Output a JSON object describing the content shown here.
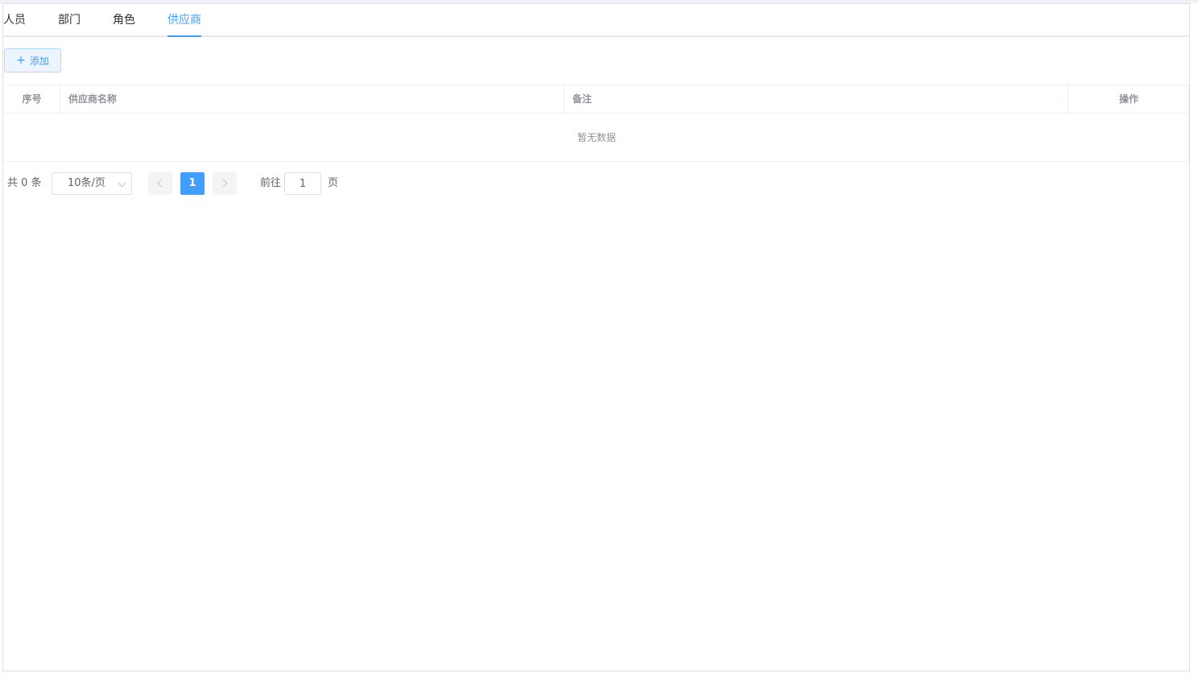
{
  "tabs": [
    {
      "label": "人员",
      "active": false
    },
    {
      "label": "部门",
      "active": false
    },
    {
      "label": "角色",
      "active": false
    },
    {
      "label": "供应商",
      "active": true
    }
  ],
  "toolbar": {
    "add_label": "添加",
    "add_icon": "+"
  },
  "table": {
    "columns": [
      "序号",
      "供应商名称",
      "备注",
      "操作"
    ],
    "rows": [],
    "empty_text": "暂无数据"
  },
  "pagination": {
    "total_text": "共 0 条",
    "page_size_label": "10条/页",
    "current_page": "1",
    "goto_prefix": "前往",
    "goto_value": "1",
    "goto_suffix": "页"
  },
  "colors": {
    "accent": "#409eff",
    "border": "#dcdfe6",
    "header_text": "#909399"
  }
}
